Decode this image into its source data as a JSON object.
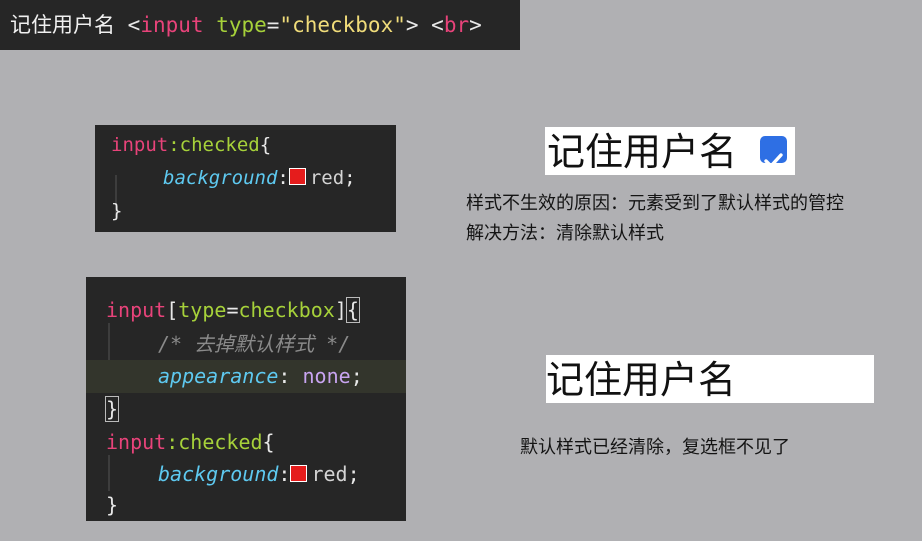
{
  "top_snippet": {
    "label": "记住用户名",
    "open_bracket": "<",
    "tag": "input",
    "attr": "type",
    "equals": "=",
    "value": "\"checkbox\"",
    "close_bracket": ">",
    "br_open": "<",
    "br_tag": "br",
    "br_close": ">"
  },
  "code1": {
    "selector": "input",
    "pseudo": ":checked",
    "brace_open": "{",
    "property": "background",
    "colon": ":",
    "value": "red",
    "semicolon": ";",
    "brace_close": "}",
    "swatch_color": "#e51c1c"
  },
  "code2": {
    "selector1": "input",
    "bracket_open": "[",
    "attr": "type",
    "equals": "=",
    "attr_value": "checkbox",
    "bracket_close": "]",
    "brace_open": "{",
    "comment": "/* 去掉默认样式 */",
    "prop1": "appearance",
    "colon": ":",
    "value1": "none",
    "semicolon": ";",
    "brace_close": "}",
    "selector2": "input",
    "pseudo": ":checked",
    "prop2": "background",
    "value2": "red",
    "swatch_color": "#e51c1c"
  },
  "demo_checked": {
    "label": "记住用户名",
    "checked": true,
    "checkbox_color": "#2e6fe4"
  },
  "note1": {
    "line1": "样式不生效的原因：元素受到了默认样式的管控",
    "line2": "解决方法：清除默认样式"
  },
  "demo_plain": {
    "label": "记住用户名"
  },
  "note2": "默认样式已经清除，复选框不见了"
}
